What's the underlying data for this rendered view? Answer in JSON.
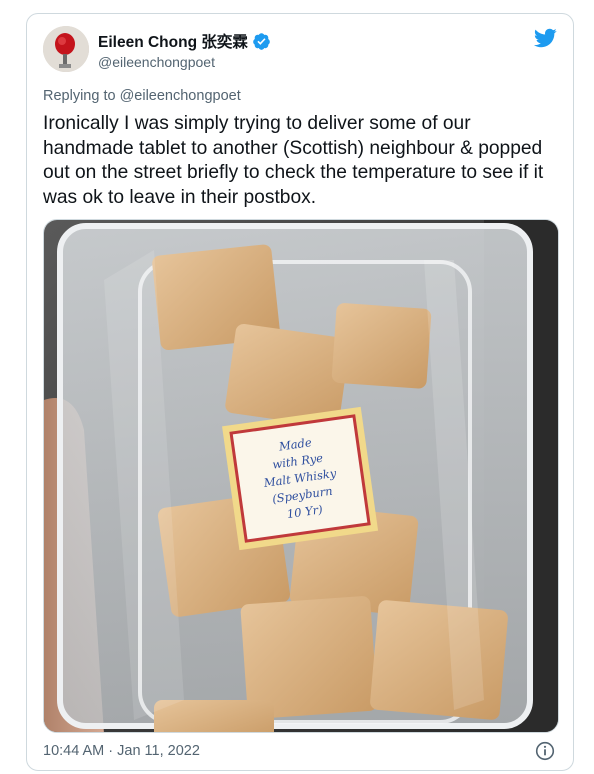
{
  "tweet": {
    "author": {
      "display_name": "Eileen Chong 张奕霖",
      "handle": "@eileenchongpoet",
      "verified": true
    },
    "replying_prefix": "Replying to",
    "replying_handle": "@eileenchongpoet",
    "text": "Ironically I was simply trying to deliver some of our handmade tablet to another (Scottish) neighbour & popped out on the street briefly to check the temperature to see if it was ok to leave in their postbox.",
    "timestamp": "10:44 AM · Jan 11, 2022",
    "media": {
      "alt": "Plastic container of handmade tablet squares with a stamp-shaped handwritten label",
      "label_lines": [
        "Made",
        "with Rye",
        "Malt Whisky",
        "(Speyburn",
        "10 Yr)"
      ]
    }
  },
  "icons": {
    "logo": "twitter-bird-icon",
    "verified": "verified-badge-icon",
    "info": "info-icon"
  },
  "colors": {
    "twitter_blue": "#1d9bf0",
    "text_primary": "#0f1419",
    "text_secondary": "#536471",
    "border": "#cfd9de"
  }
}
